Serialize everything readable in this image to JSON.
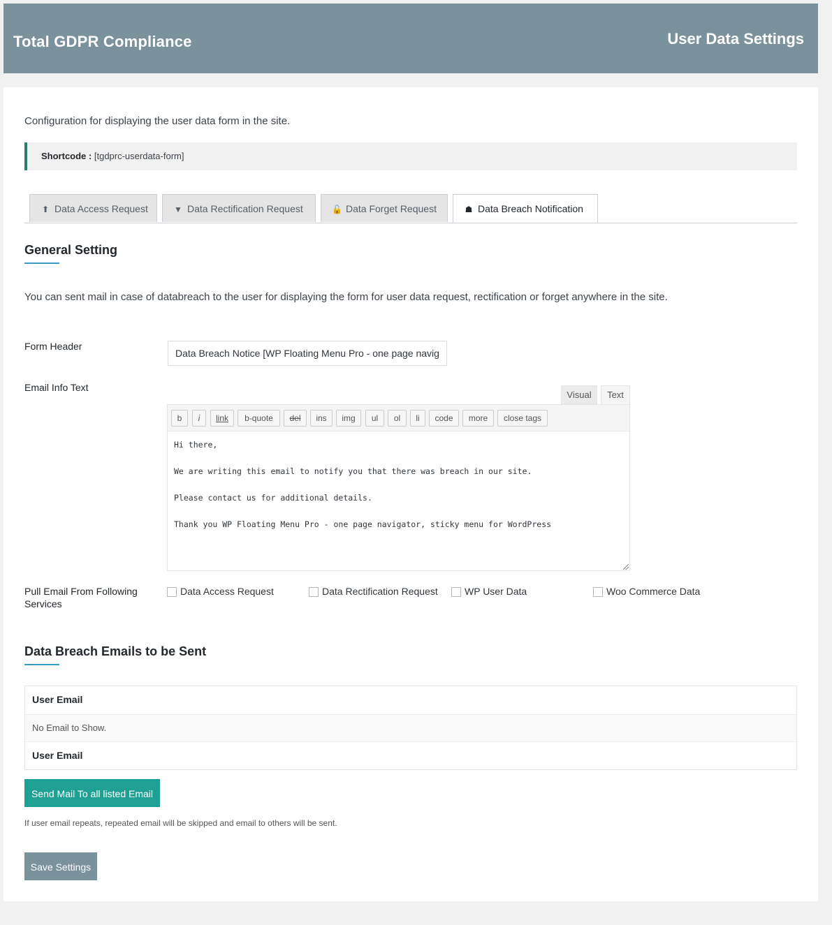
{
  "header": {
    "app_title": "Total GDPR Compliance",
    "page_title": "User Data Settings"
  },
  "intro": "Configuration for displaying the user data form in the site.",
  "shortcode": {
    "label": "Shortcode :",
    "value": "[tgdprc-userdata-form]"
  },
  "tabs": [
    {
      "label": "Data Access Request",
      "icon": "upload-icon",
      "glyph": "⬆",
      "active": false
    },
    {
      "label": "Data Rectification Request",
      "icon": "filter-icon",
      "glyph": "▼",
      "active": false
    },
    {
      "label": "Data Forget Request",
      "icon": "unlock-icon",
      "glyph": "🔓",
      "active": false
    },
    {
      "label": "Data Breach Notification",
      "icon": "user-secret-icon",
      "glyph": "☗",
      "active": true
    }
  ],
  "general": {
    "title": "General Setting",
    "description": "You can sent mail in case of databreach to the user for displaying the form for user data request, rectification or forget anywhere in the site."
  },
  "form": {
    "header_label": "Form Header",
    "header_value": "Data Breach Notice [WP Floating Menu Pro - one page navigator, sticky menu for WordPress]",
    "email_info_label": "Email Info Text",
    "editor_tabs": [
      "Visual",
      "Text"
    ],
    "quicktags": [
      "b",
      "i",
      "link",
      "b-quote",
      "del",
      "ins",
      "img",
      "ul",
      "ol",
      "li",
      "code",
      "more",
      "close tags"
    ],
    "email_lines": [
      "Hi there,",
      "",
      "We are writing this email to notify you that there was breach in our site.",
      "",
      "Please contact us for additional details.",
      "",
      "Thank you WP Floating Menu Pro - one page navigator, sticky menu for WordPress"
    ],
    "pull_label": "Pull Email From Following Services",
    "services": [
      {
        "label": "Data Access Request",
        "checked": false
      },
      {
        "label": "Data Rectification Request",
        "checked": false
      },
      {
        "label": "WP User Data",
        "checked": false
      },
      {
        "label": "Woo Commerce Data",
        "checked": false
      }
    ]
  },
  "breach": {
    "title": "Data Breach Emails to be Sent",
    "table_header": "User Email",
    "empty_text": "No Email to Show.",
    "table_footer": "User Email",
    "send_button": "Send Mail To all listed Email",
    "note": "If user email repeats, repeated email will be skipped and email to others will be sent."
  },
  "save_button": "Save Settings",
  "colors": {
    "header_bg": "#7a929c",
    "accent": "#1fa094",
    "underline": "#3c9cc9"
  }
}
